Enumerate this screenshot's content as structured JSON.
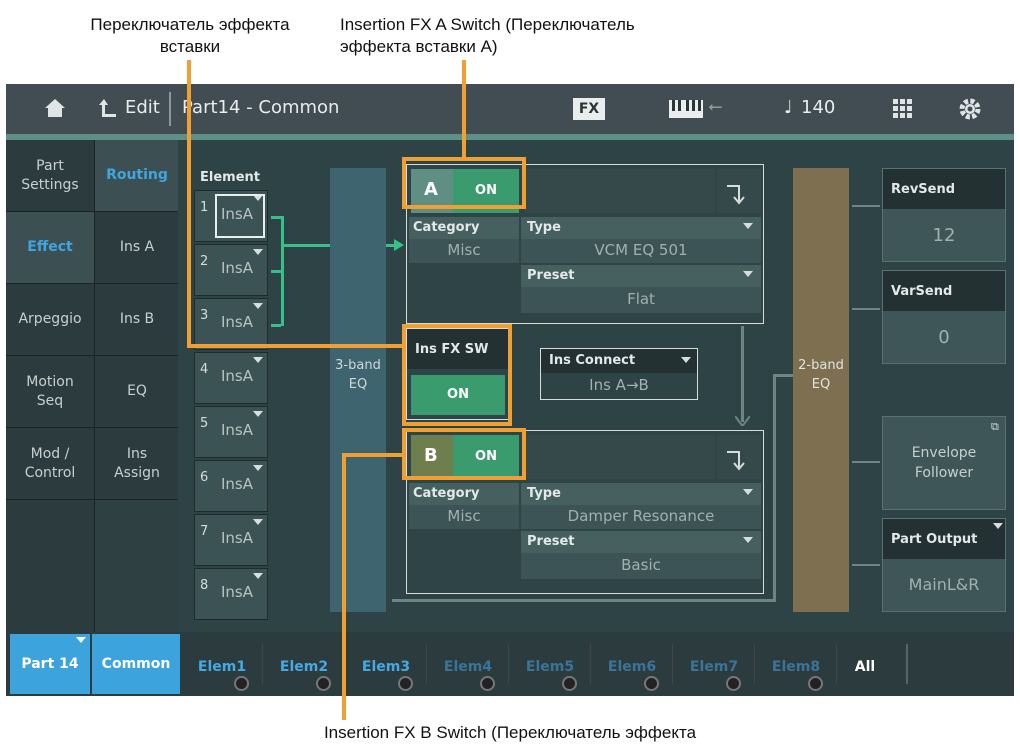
{
  "annotations": {
    "ins_switch": [
      "Переключатель эффекта",
      "вставки"
    ],
    "ins_a_switch": [
      "Insertion FX A Switch (Переключатель",
      "эффекта вставки A)"
    ],
    "ins_b_switch": "Insertion FX B Switch (Переключатель эффекта"
  },
  "header": {
    "edit_label": "Edit",
    "title": "Part14 - Common",
    "fx_badge": "FX",
    "tempo_note": "♩",
    "tempo": "140"
  },
  "left_tabs": [
    {
      "label": "Part\nSettings"
    },
    {
      "label": "Effect"
    },
    {
      "label": "Arpeggio"
    },
    {
      "label": "Motion\nSeq"
    },
    {
      "label": "Mod /\nControl"
    }
  ],
  "sub_tabs": [
    {
      "label": "Routing"
    },
    {
      "label": "Ins A"
    },
    {
      "label": "Ins B"
    },
    {
      "label": "EQ"
    },
    {
      "label": "Ins\nAssign"
    }
  ],
  "elements": {
    "title": "Element",
    "items": [
      {
        "num": "1",
        "value": "InsA"
      },
      {
        "num": "2",
        "value": "InsA"
      },
      {
        "num": "3",
        "value": "InsA"
      },
      {
        "num": "4",
        "value": "InsA"
      },
      {
        "num": "5",
        "value": "InsA"
      },
      {
        "num": "6",
        "value": "InsA"
      },
      {
        "num": "7",
        "value": "InsA"
      },
      {
        "num": "8",
        "value": "InsA"
      }
    ]
  },
  "eq3": {
    "line1": "3-band",
    "line2": "EQ"
  },
  "eq2": {
    "line1": "2-band",
    "line2": "EQ"
  },
  "ins_a": {
    "letter": "A",
    "switch": "ON",
    "category_label": "Category",
    "category": "Misc",
    "type_label": "Type",
    "type": "VCM EQ 501",
    "preset_label": "Preset",
    "preset": "Flat"
  },
  "ins_fx_sw": {
    "label": "Ins FX SW",
    "value": "ON"
  },
  "ins_connect": {
    "label": "Ins Connect",
    "value": "Ins A→B"
  },
  "ins_b": {
    "letter": "B",
    "switch": "ON",
    "category_label": "Category",
    "category": "Misc",
    "type_label": "Type",
    "type": "Damper Resonance",
    "preset_label": "Preset",
    "preset": "Basic"
  },
  "right": {
    "rev_send_label": "RevSend",
    "rev_send": "12",
    "var_send_label": "VarSend",
    "var_send": "0",
    "envelope_follower": "Envelope\nFollower",
    "part_output_label": "Part Output",
    "part_output": "MainL&R"
  },
  "bottom_tabs": {
    "part": "Part 14",
    "common": "Common",
    "elems": [
      "Elem1",
      "Elem2",
      "Elem3",
      "Elem4",
      "Elem5",
      "Elem6",
      "Elem7",
      "Elem8"
    ],
    "all": "All"
  },
  "colors": {
    "accent": "#45a9e3",
    "on": "#3a9b6e",
    "highlight": "#f0a033"
  }
}
